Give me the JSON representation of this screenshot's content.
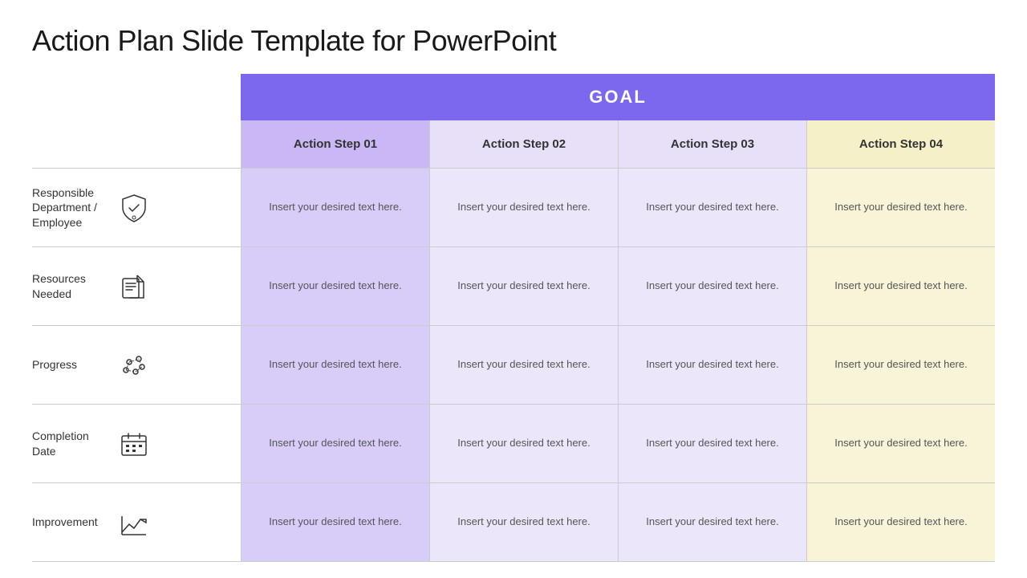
{
  "title": "Action Plan Slide Template for PowerPoint",
  "goal_label": "GOAL",
  "columns": [
    {
      "id": "step01",
      "label": "Action Step 01"
    },
    {
      "id": "step02",
      "label": "Action Step 02"
    },
    {
      "id": "step03",
      "label": "Action Step 03"
    },
    {
      "id": "step04",
      "label": "Action Step 04"
    }
  ],
  "rows": [
    {
      "label": "Responsible Department / Employee",
      "icon": "shield",
      "cells": [
        "Insert your desired text here.",
        "Insert your desired text here.",
        "Insert your desired text here.",
        "Insert your desired text here."
      ]
    },
    {
      "label": "Resources Needed",
      "icon": "resources",
      "cells": [
        "Insert your desired text here.",
        "Insert your desired text here.",
        "Insert your desired text here.",
        "Insert your desired text here."
      ]
    },
    {
      "label": "Progress",
      "icon": "progress",
      "cells": [
        "Insert your desired text here.",
        "Insert your desired text here.",
        "Insert your desired text here.",
        "Insert your desired text here."
      ]
    },
    {
      "label": "Completion Date",
      "icon": "calendar",
      "cells": [
        "Insert your desired text here.",
        "Insert your desired text here.",
        "Insert your desired text here.",
        "Insert your desired text here."
      ]
    },
    {
      "label": "Improvement",
      "icon": "improvement",
      "cells": [
        "Insert your desired text here.",
        "Insert your desired text here.",
        "Insert your desired text here.",
        "Insert your desired text here."
      ]
    }
  ],
  "cell_placeholder": "Insert your desired text here."
}
